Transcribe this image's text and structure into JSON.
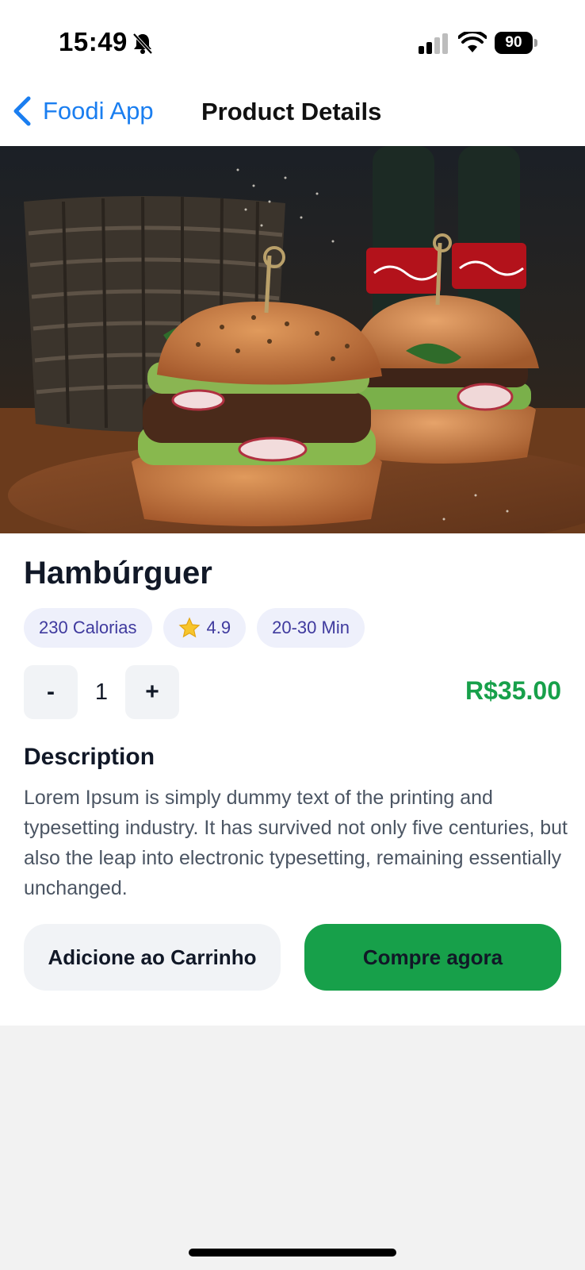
{
  "status_bar": {
    "time": "15:49",
    "battery": "90"
  },
  "nav": {
    "back_label": "Foodi App",
    "title": "Product Details"
  },
  "product": {
    "name": "Hambúrguer",
    "chips": {
      "calories": "230 Calorias",
      "rating": "4.9",
      "time": "20-30 Min"
    },
    "quantity": {
      "minus": "-",
      "value": "1",
      "plus": "+"
    },
    "price": "R$35.00",
    "description_heading": "Description",
    "description": "Lorem Ipsum is simply dummy text of the printing and typesetting industry. It has survived not only five centuries, but also the leap into electronic typesetting, remaining essentially unchanged."
  },
  "actions": {
    "add_to_cart": "Adicione ao Carrinho",
    "buy_now": "Compre agora"
  },
  "colors": {
    "accent": "#1a7ef0",
    "price": "#17a04a",
    "buy_button": "#17a04a",
    "chip_bg": "#eef0fb",
    "chip_text": "#3f3a9e"
  },
  "icons": [
    "back-chevron-icon",
    "bell-muted-icon",
    "signal-icon",
    "wifi-icon",
    "battery-icon",
    "star-icon"
  ]
}
